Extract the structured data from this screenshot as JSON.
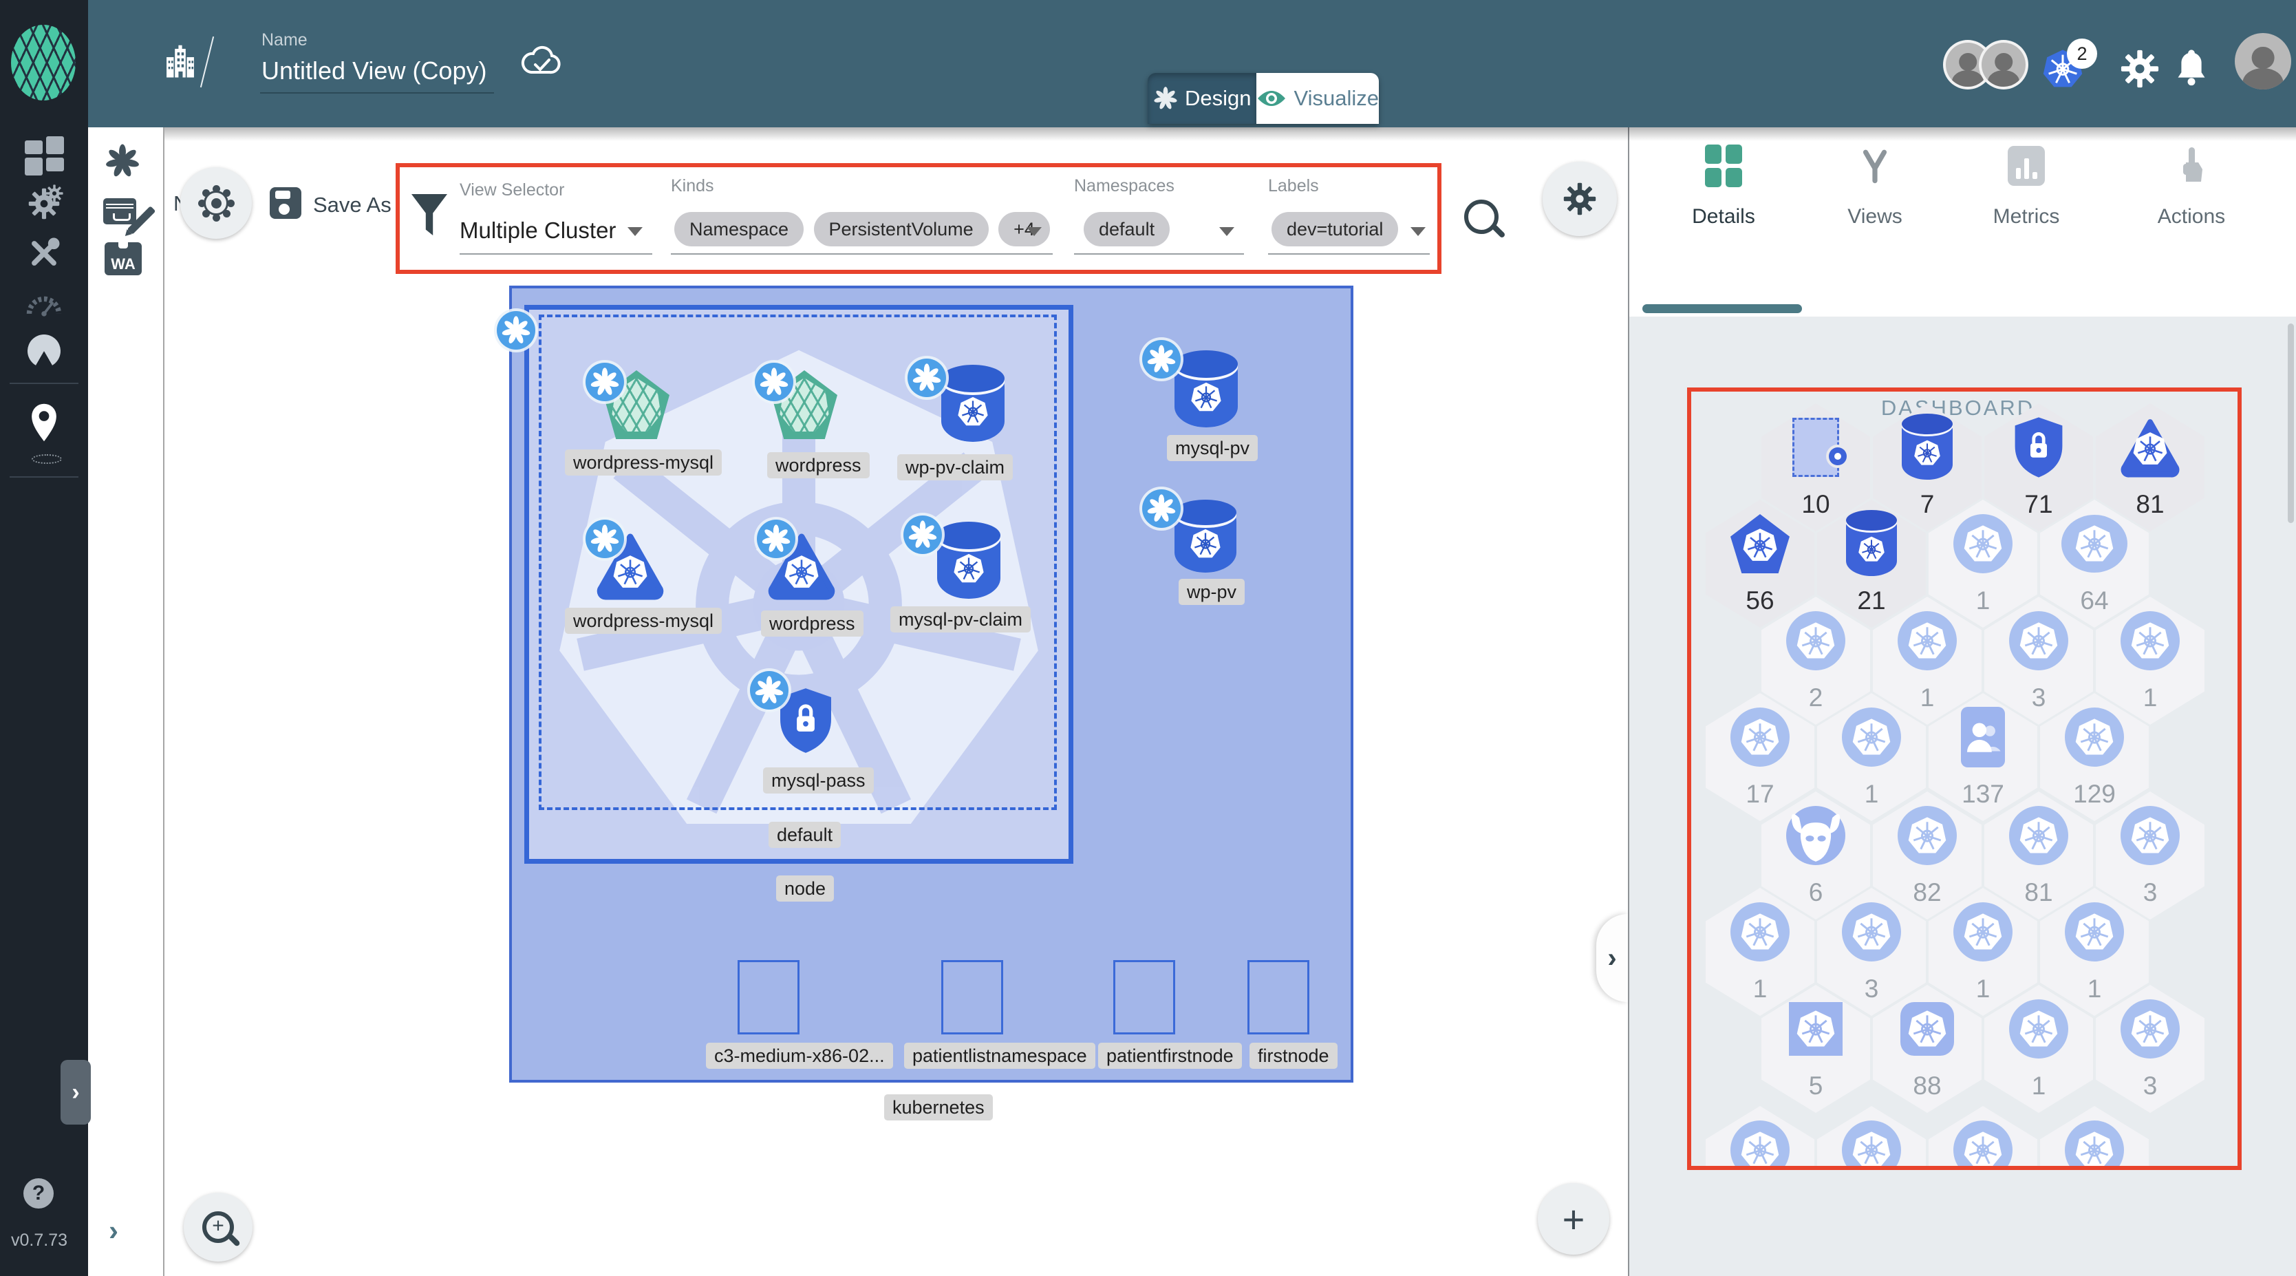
{
  "app": {
    "version": "v0.7.73"
  },
  "header": {
    "name_label": "Name",
    "name_value": "Untitled View (Copy)",
    "mode_design": "Design",
    "mode_visualize": "Visualize",
    "k8s_context_badge": "2"
  },
  "toolbar": {
    "new_label": "New",
    "save_as_label": "Save As",
    "view_selector": {
      "label": "View Selector",
      "value": "Multiple Cluster"
    },
    "kinds": {
      "label": "Kinds",
      "chips": [
        "Namespace",
        "PersistentVolume",
        "+4"
      ]
    },
    "namespaces": {
      "label": "Namespaces",
      "value": "default"
    },
    "labels": {
      "label": "Labels",
      "value": "dev=tutorial"
    }
  },
  "canvas": {
    "cluster": "kubernetes",
    "node": "node",
    "namespace": "default",
    "svc1": "wordpress-mysql",
    "svc2": "wordpress",
    "pvc1": "wp-pv-claim",
    "dep1": "wordpress-mysql",
    "dep2": "wordpress",
    "pvc2": "mysql-pv-claim",
    "secret": "mysql-pass",
    "pv1": "mysql-pv",
    "pv2": "wp-pv",
    "hostnode1": "c3-medium-x86-02...",
    "hostnode2": "patientlistnamespace",
    "hostnode3": "patientfirstnode",
    "hostnode4": "firstnode"
  },
  "panel": {
    "tabs": [
      {
        "label": "Details"
      },
      {
        "label": "Views"
      },
      {
        "label": "Metrics"
      },
      {
        "label": "Actions"
      }
    ],
    "section": "DASHBOARD",
    "hexgrid": {
      "rows": [
        {
          "offset": "right",
          "cells": [
            {
              "icon": "namespace",
              "value": "10",
              "tone": "strong"
            },
            {
              "icon": "cylinder",
              "value": "7",
              "tone": "strong"
            },
            {
              "icon": "shield",
              "value": "71",
              "tone": "strong"
            },
            {
              "icon": "triangle",
              "value": "81",
              "tone": "strong"
            }
          ]
        },
        {
          "offset": "left",
          "cells": [
            {
              "icon": "pentagon",
              "value": "56",
              "tone": "strong"
            },
            {
              "icon": "cylinder",
              "value": "21",
              "tone": "strong"
            },
            {
              "icon": "wheel-circle",
              "value": "1",
              "tone": "soft"
            },
            {
              "icon": "wheel-ellipse",
              "value": "64",
              "tone": "soft"
            }
          ]
        },
        {
          "offset": "right",
          "cells": [
            {
              "icon": "wheel-circle",
              "value": "2",
              "tone": "soft"
            },
            {
              "icon": "wheel-circle",
              "value": "1",
              "tone": "soft"
            },
            {
              "icon": "wheel-circle",
              "value": "3",
              "tone": "soft"
            },
            {
              "icon": "wheel-circle",
              "value": "1",
              "tone": "soft"
            }
          ]
        },
        {
          "offset": "left",
          "cells": [
            {
              "icon": "wheel-circle",
              "value": "17",
              "tone": "soft"
            },
            {
              "icon": "wheel-circle",
              "value": "1",
              "tone": "soft"
            },
            {
              "icon": "user-card",
              "value": "137",
              "tone": "soft"
            },
            {
              "icon": "wheel-circle",
              "value": "129",
              "tone": "soft"
            }
          ]
        },
        {
          "offset": "right",
          "cells": [
            {
              "icon": "mask",
              "value": "6",
              "tone": "soft"
            },
            {
              "icon": "wheel-circle",
              "value": "82",
              "tone": "soft"
            },
            {
              "icon": "wheel-circle",
              "value": "81",
              "tone": "soft"
            },
            {
              "icon": "wheel-circle",
              "value": "3",
              "tone": "soft"
            }
          ]
        },
        {
          "offset": "left",
          "cells": [
            {
              "icon": "wheel-circle",
              "value": "1",
              "tone": "soft"
            },
            {
              "icon": "wheel-circle",
              "value": "3",
              "tone": "soft"
            },
            {
              "icon": "wheel-circle",
              "value": "1",
              "tone": "soft"
            },
            {
              "icon": "wheel-circle",
              "value": "1",
              "tone": "soft"
            }
          ]
        },
        {
          "offset": "right",
          "cells": [
            {
              "icon": "square",
              "value": "5",
              "tone": "soft"
            },
            {
              "icon": "rounded-square",
              "value": "88",
              "tone": "soft"
            },
            {
              "icon": "wheel-circle",
              "value": "1",
              "tone": "soft"
            },
            {
              "icon": "wheel-circle",
              "value": "3",
              "tone": "soft"
            }
          ]
        },
        {
          "offset": "left",
          "cells": [
            {
              "icon": "wheel-circle",
              "value": "",
              "tone": "soft"
            },
            {
              "icon": "wheel-circle",
              "value": "",
              "tone": "soft"
            },
            {
              "icon": "wheel-circle",
              "value": "",
              "tone": "soft"
            },
            {
              "icon": "wheel-circle",
              "value": "",
              "tone": "soft"
            }
          ]
        }
      ]
    }
  },
  "icons": {
    "wasm_text": "WA"
  },
  "colors": {
    "annotation_red": "#e8432c",
    "header_teal": "#3f6374",
    "k8s_blue": "#3d63d9",
    "light_blue": "#a9c0f0",
    "meshery_teal": "#3f9e8a",
    "service_green": "#4fae96"
  }
}
